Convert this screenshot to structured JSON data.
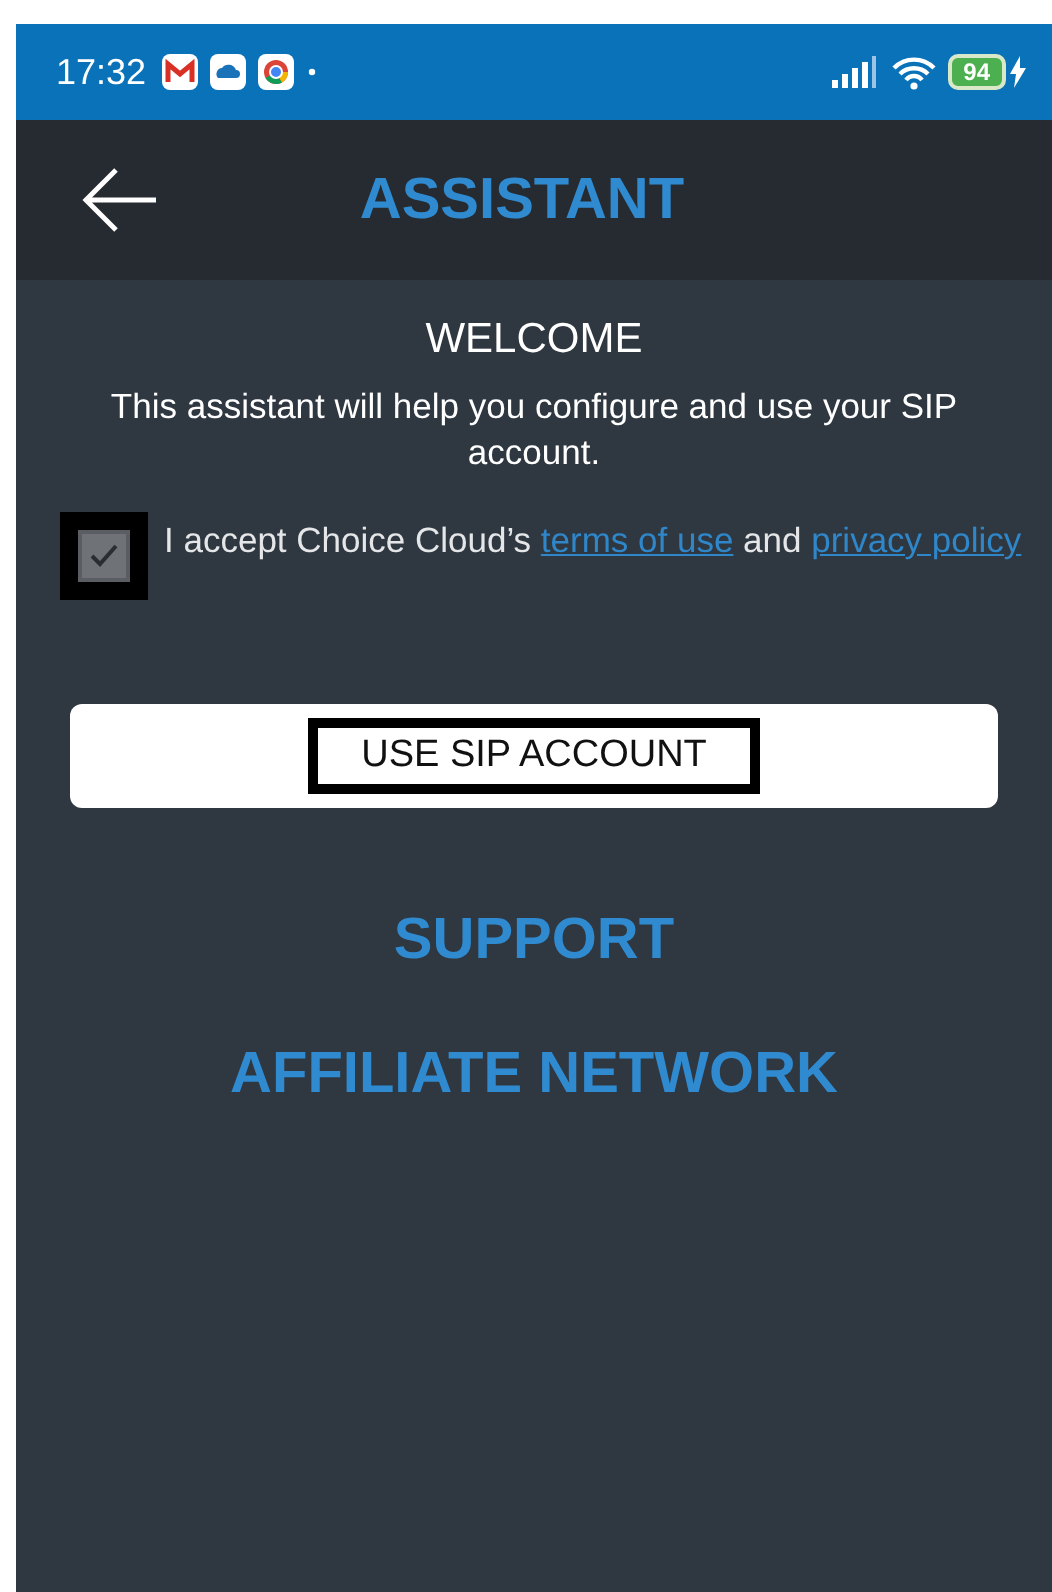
{
  "status_bar": {
    "time": "17:32",
    "battery": "94",
    "charging": true
  },
  "toolbar": {
    "title": "ASSISTANT"
  },
  "welcome": {
    "title": "WELCOME",
    "description": "This assistant will help you configure and use your SIP account."
  },
  "terms": {
    "checked": true,
    "focused": true,
    "prefix": "I accept Choice Cloud’s",
    "link_terms": "terms of use",
    "middle": "and",
    "link_privacy": "privacy policy"
  },
  "primary_button": {
    "label": "USE SIP ACCOUNT",
    "focused": true
  },
  "links": [
    {
      "label": "SUPPORT"
    },
    {
      "label": "AFFILIATE NETWORK"
    }
  ]
}
